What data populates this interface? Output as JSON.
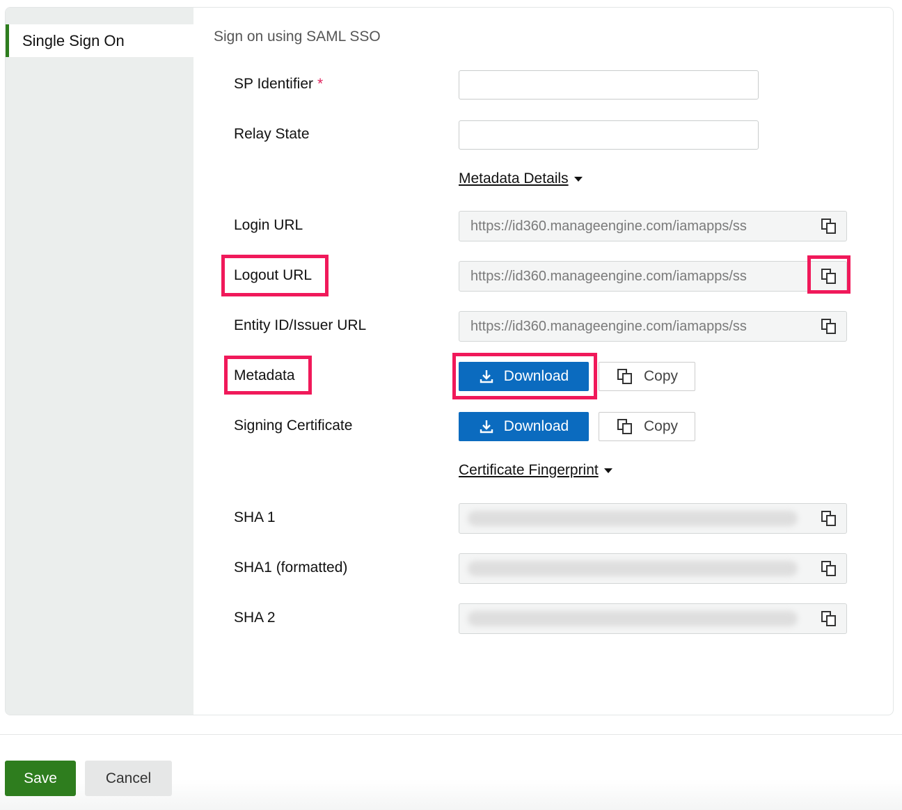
{
  "sidebar": {
    "items": [
      {
        "label": "Single Sign On",
        "active": true
      }
    ]
  },
  "form": {
    "section_title": "Sign on using SAML SSO",
    "sp_identifier": {
      "label": "SP Identifier",
      "required_mark": "*",
      "value": ""
    },
    "relay_state": {
      "label": "Relay State",
      "value": ""
    },
    "metadata_details_toggle": "Metadata Details",
    "login_url": {
      "label": "Login URL",
      "value": "https://id360.manageengine.com/iamapps/ss"
    },
    "logout_url": {
      "label": "Logout URL",
      "value": "https://id360.manageengine.com/iamapps/ss"
    },
    "entity_id": {
      "label": "Entity ID/Issuer URL",
      "value": "https://id360.manageengine.com/iamapps/ss"
    },
    "metadata": {
      "label": "Metadata",
      "download_label": "Download",
      "copy_label": "Copy"
    },
    "signing_certificate": {
      "label": "Signing Certificate",
      "download_label": "Download",
      "copy_label": "Copy"
    },
    "certificate_fingerprint_toggle": "Certificate Fingerprint",
    "sha1": {
      "label": "SHA 1"
    },
    "sha1_formatted": {
      "label": "SHA1 (formatted)"
    },
    "sha2": {
      "label": "SHA 2"
    }
  },
  "footer": {
    "save_label": "Save",
    "cancel_label": "Cancel"
  },
  "colors": {
    "accent_green": "#2e7d1e",
    "primary_blue": "#0b6bbf",
    "highlight_pink": "#f0195a",
    "required_red": "#e0245e"
  },
  "icons": {
    "copy": "copy-icon",
    "download": "download-icon",
    "caret": "caret-down-icon"
  }
}
